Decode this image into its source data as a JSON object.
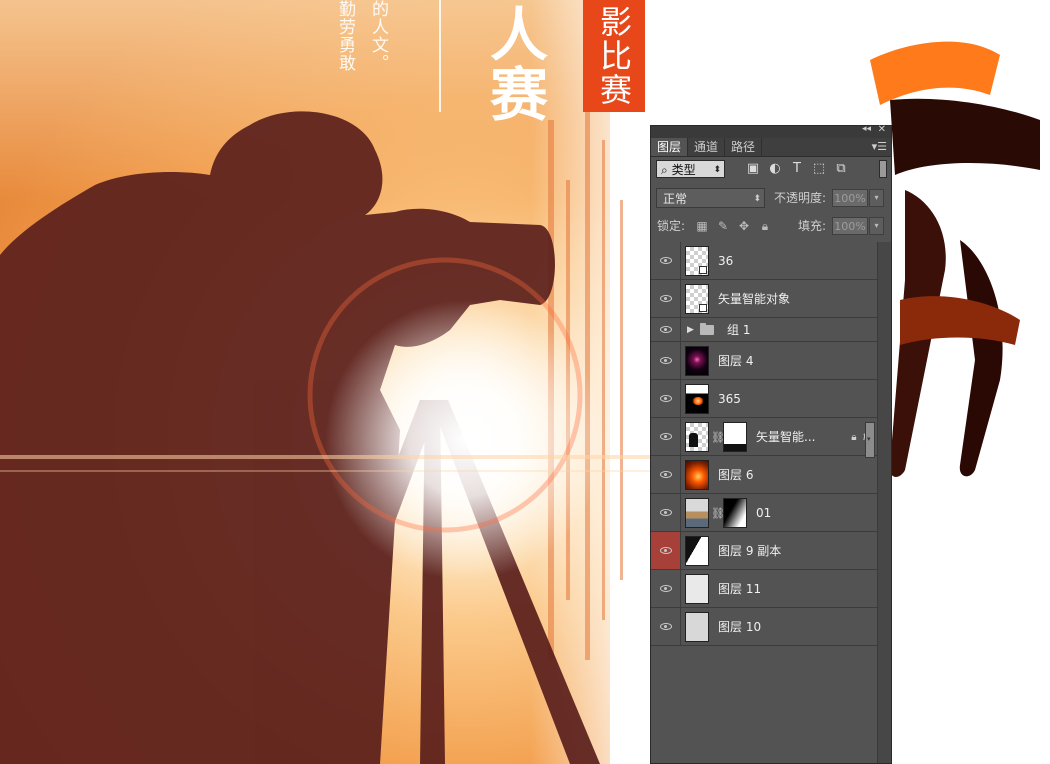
{
  "poster": {
    "vertical_text_1": "勤劳勇敢",
    "vertical_text_2": "的人文。",
    "big_chars": [
      "人",
      "赛"
    ],
    "badge_text": "影比赛",
    "colors": {
      "badge": "#e8471a",
      "silhouette": "#5a1f1c",
      "glow": "#fff6e6"
    }
  },
  "panel": {
    "tabs": [
      {
        "label": "图层",
        "active": true
      },
      {
        "label": "通道",
        "active": false
      },
      {
        "label": "路径",
        "active": false
      }
    ],
    "collapse_icon": "double-chevron-left-icon",
    "close_icon": "close-icon",
    "menu_icon": "panel-menu-icon",
    "filter": {
      "selected": "类型",
      "search_icon": "magnifier-icon",
      "icons": [
        "image-filter-icon",
        "adjustment-filter-icon",
        "text-filter-icon",
        "shape-filter-icon",
        "smart-object-filter-icon"
      ]
    },
    "blend": {
      "mode": "正常",
      "opacity_label": "不透明度:",
      "opacity_value": "100%"
    },
    "lock": {
      "label": "锁定:",
      "icons": [
        "lock-transparent-icon",
        "lock-paint-icon",
        "lock-move-icon",
        "lock-all-icon"
      ],
      "fill_label": "填充:",
      "fill_value": "100%"
    },
    "layers": [
      {
        "name": "36",
        "thumb": "smart",
        "visible": true
      },
      {
        "name": "矢量智能对象",
        "thumb": "smart",
        "visible": true
      },
      {
        "name": "组 1",
        "type": "group",
        "visible": true
      },
      {
        "name": "图层 4",
        "thumb": "dark-glow",
        "visible": true
      },
      {
        "name": "365",
        "thumb": "flare-w",
        "visible": true
      },
      {
        "name": "矢量智能...",
        "thumb": "silhouette",
        "mask": "white-bottom",
        "fx": "fx",
        "visible": true
      },
      {
        "name": "图层 6",
        "thumb": "orange",
        "visible": true
      },
      {
        "name": "01",
        "thumb": "landscape",
        "mask": "diagonal",
        "visible": true
      },
      {
        "name": "图层 9 副本",
        "thumb": "half-dark",
        "visible": true,
        "eye_highlight": true
      },
      {
        "name": "图层 11",
        "thumb": "plain-light",
        "visible": true
      },
      {
        "name": "图层 10",
        "thumb": "plain-gray",
        "visible": true
      }
    ]
  }
}
